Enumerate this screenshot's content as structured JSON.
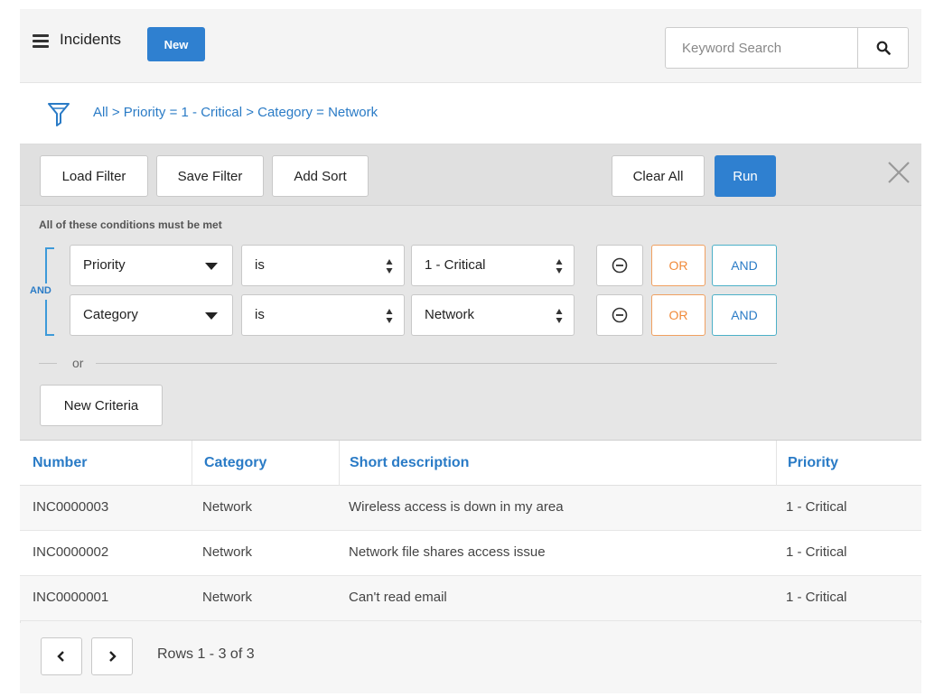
{
  "header": {
    "title": "Incidents",
    "new_label": "New",
    "search_placeholder": "Keyword Search"
  },
  "breadcrumb": {
    "text": "All > Priority = 1 - Critical > Category = Network"
  },
  "toolbar": {
    "load_filter": "Load Filter",
    "save_filter": "Save Filter",
    "add_sort": "Add Sort",
    "clear_all": "Clear All",
    "run": "Run"
  },
  "conditions": {
    "label": "All of these conditions must be met",
    "group_operator": "AND",
    "rows": [
      {
        "field": "Priority",
        "operator": "is",
        "value": "1 - Critical",
        "or_label": "OR",
        "and_label": "AND"
      },
      {
        "field": "Category",
        "operator": "is",
        "value": "Network",
        "or_label": "OR",
        "and_label": "AND"
      }
    ],
    "or_separator": "or",
    "new_criteria": "New Criteria"
  },
  "table": {
    "columns": [
      "Number",
      "Category",
      "Short description",
      "Priority"
    ],
    "rows": [
      [
        "INC0000003",
        "Network",
        "Wireless access is down in my area",
        "1 - Critical"
      ],
      [
        "INC0000002",
        "Network",
        "Network file shares access issue",
        "1 - Critical"
      ],
      [
        "INC0000001",
        "Network",
        "Can't read email",
        "1 - Critical"
      ]
    ]
  },
  "pagination": {
    "rows_info": "Rows 1 - 3 of 3"
  },
  "colors": {
    "accent": "#2f80d0",
    "link": "#2a7bc6",
    "or_orange": "#f08a3a",
    "and_teal": "#4cb0c8"
  }
}
